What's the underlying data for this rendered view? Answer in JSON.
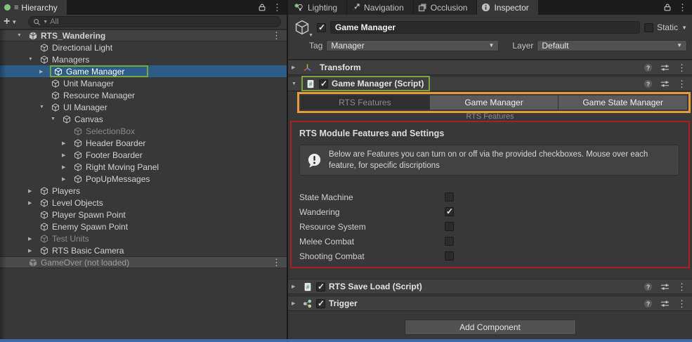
{
  "colors": {
    "selection_blue": "#2D5C87",
    "annotation_green": "#79A63F",
    "annotation_orange": "#E79A3C",
    "annotation_red": "#AF1E1E",
    "footer_blue": "#3E6CA8"
  },
  "hierarchy": {
    "tab_label": "Hierarchy",
    "add_label": "+",
    "search_placeholder": "All",
    "items": [
      {
        "label": "RTS_Wandering",
        "icon": "scene",
        "depth": 0,
        "arrow": "down",
        "scene": true,
        "kebab": true
      },
      {
        "label": "Directional Light",
        "icon": "cube",
        "depth": 1,
        "arrow": "none"
      },
      {
        "label": "Managers",
        "icon": "cube",
        "depth": 1,
        "arrow": "down"
      },
      {
        "label": "Game Manager",
        "icon": "cube",
        "depth": 2,
        "arrow": "right",
        "selected": true,
        "annotated": true
      },
      {
        "label": "Unit Manager",
        "icon": "cube",
        "depth": 2,
        "arrow": "none"
      },
      {
        "label": "Resource Manager",
        "icon": "cube",
        "depth": 2,
        "arrow": "none"
      },
      {
        "label": "UI Manager",
        "icon": "cube",
        "depth": 2,
        "arrow": "down"
      },
      {
        "label": "Canvas",
        "icon": "cube",
        "depth": 3,
        "arrow": "down"
      },
      {
        "label": "SelectionBox",
        "icon": "cube",
        "depth": 4,
        "arrow": "none",
        "dimmed": true
      },
      {
        "label": "Header Boarder",
        "icon": "cube",
        "depth": 4,
        "arrow": "right"
      },
      {
        "label": "Footer Boarder",
        "icon": "cube",
        "depth": 4,
        "arrow": "right"
      },
      {
        "label": "Right Moving Panel",
        "icon": "cube",
        "depth": 4,
        "arrow": "right"
      },
      {
        "label": "PopUpMessages",
        "icon": "cube",
        "depth": 4,
        "arrow": "right"
      },
      {
        "label": "Players",
        "icon": "cube",
        "depth": 1,
        "arrow": "right"
      },
      {
        "label": "Level Objects",
        "icon": "cube",
        "depth": 1,
        "arrow": "right"
      },
      {
        "label": "Player Spawn Point",
        "icon": "cube",
        "depth": 1,
        "arrow": "none"
      },
      {
        "label": "Enemy Spawn Point",
        "icon": "cube",
        "depth": 1,
        "arrow": "none"
      },
      {
        "label": "Test Units",
        "icon": "cube",
        "depth": 1,
        "arrow": "right",
        "dimmed": true
      },
      {
        "label": "RTS Basic Camera",
        "icon": "cube",
        "depth": 1,
        "arrow": "right"
      },
      {
        "label": "GameOver (not loaded)",
        "icon": "scene",
        "depth": 0,
        "arrow": "none",
        "scene": true,
        "dimmed": true,
        "kebab": true
      }
    ]
  },
  "inspector": {
    "tabs": [
      {
        "label": "Lighting"
      },
      {
        "label": "Navigation"
      },
      {
        "label": "Occlusion"
      },
      {
        "label": "Inspector"
      }
    ],
    "header": {
      "name": "Game Manager",
      "static_label": "Static",
      "tag_label": "Tag",
      "tag_value": "Manager",
      "layer_label": "Layer",
      "layer_value": "Default"
    },
    "components": {
      "transform": {
        "title": "Transform"
      },
      "game_manager": {
        "title": "Game Manager (Script)",
        "tabs": [
          {
            "label": "RTS Features",
            "selected": true
          },
          {
            "label": "Game Manager"
          },
          {
            "label": "Game State Manager"
          }
        ],
        "subtitle": "RTS Features",
        "section_title": "RTS Module Features and Settings",
        "help_text": "Below are Features you can turn on or off via the provided checkboxes. Mouse over each feature, for specific discriptions",
        "features": [
          {
            "label": "State Machine",
            "checked": false
          },
          {
            "label": "Wandering",
            "checked": true
          },
          {
            "label": "Resource System",
            "checked": false
          },
          {
            "label": "Melee Combat",
            "checked": false
          },
          {
            "label": "Shooting Combat",
            "checked": false
          }
        ]
      },
      "rts_save_load": {
        "title": "RTS Save Load (Script)"
      },
      "trigger": {
        "title": "Trigger"
      }
    },
    "add_component_label": "Add Component"
  }
}
